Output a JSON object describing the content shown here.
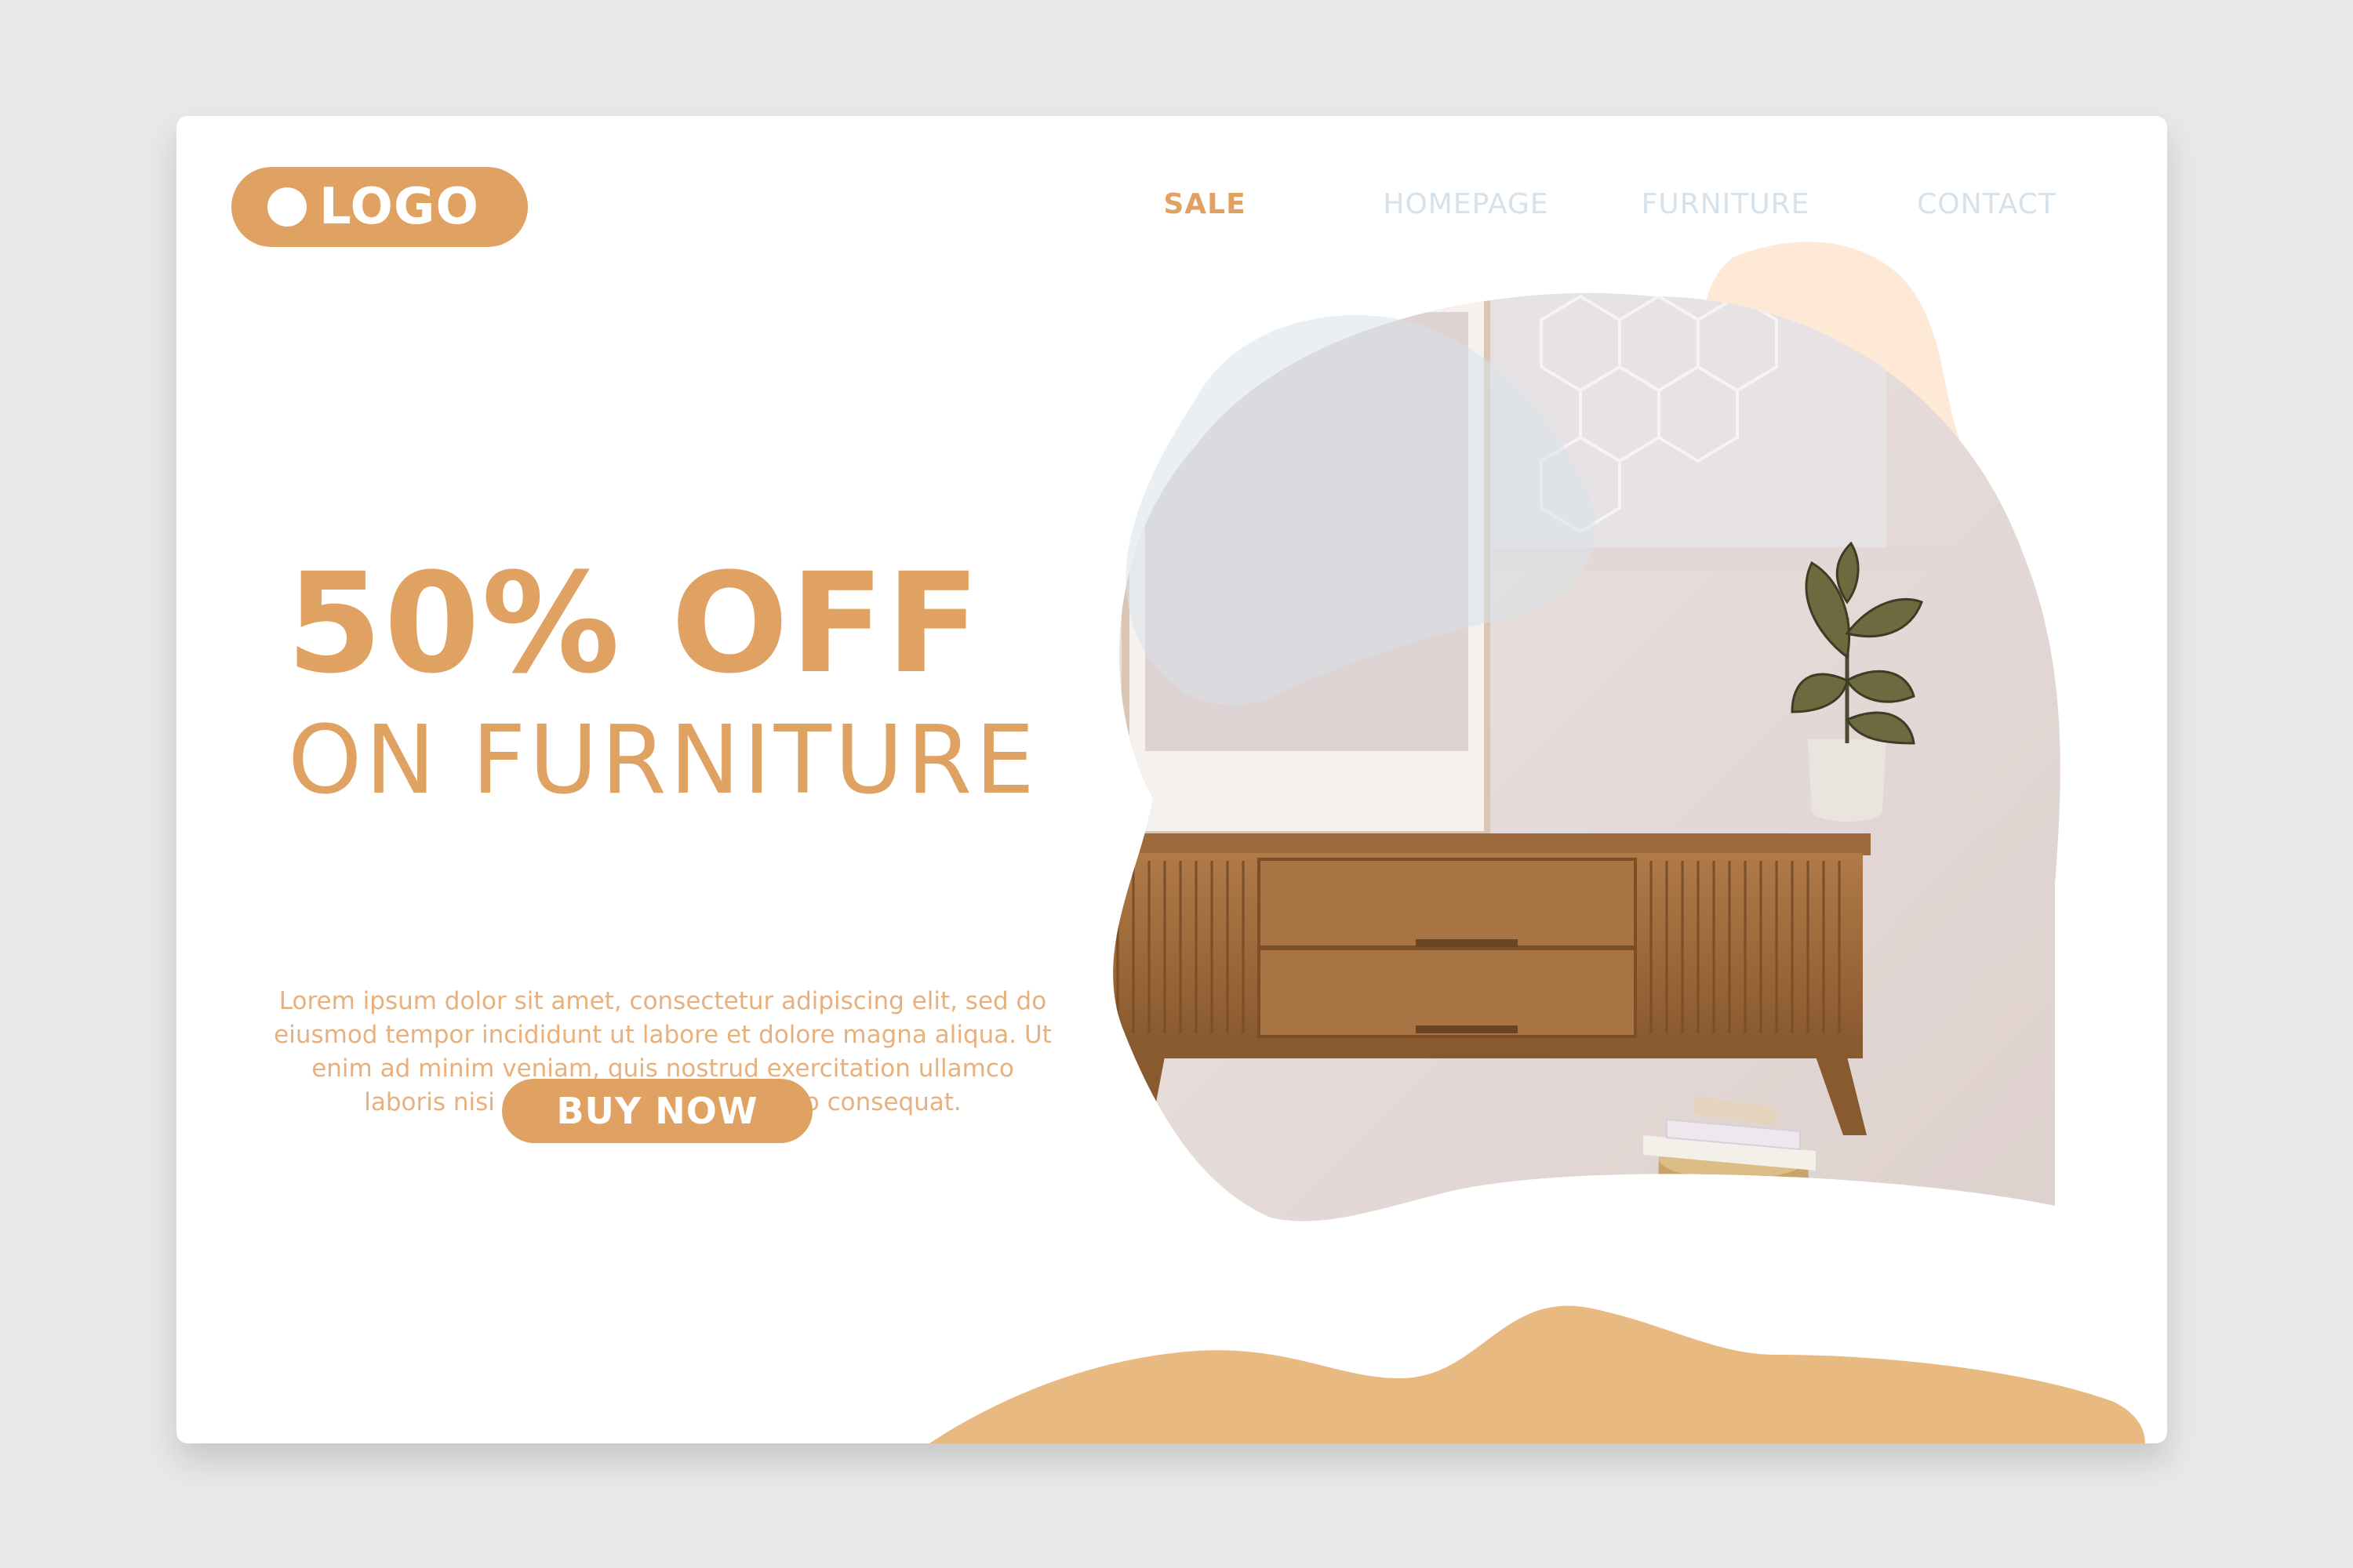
{
  "logo": {
    "text": "LOGO"
  },
  "nav": {
    "items": [
      {
        "label": "SALE",
        "active": true
      },
      {
        "label": "HOMEPAGE",
        "active": false
      },
      {
        "label": "FURNITURE",
        "active": false
      },
      {
        "label": "CONTACT",
        "active": false
      }
    ]
  },
  "hero": {
    "headline": "50% OFF",
    "subheadline": "ON FURNITURE",
    "body": "Lorem ipsum dolor sit amet, consectetur adipiscing elit, sed do eiusmod tempor incididunt ut labore et dolore magna aliqua. Ut enim ad minim veniam, quis nostrud exercitation ullamco laboris nisi ut aliquip ex ea commodo consequat.",
    "cta_label": "BUY NOW"
  },
  "colors": {
    "background": "#e9e8e9",
    "card": "#ffffff",
    "accent": "#e0a262",
    "accent_light": "#e9b982",
    "peach": "#fde9d6",
    "blue_gray": "#e4eaf0",
    "nav_inactive": "#d6e1ea"
  },
  "image": {
    "description_icon": "furniture-photo",
    "elements": [
      "wooden-sideboard-icon",
      "potted-plant-icon",
      "picture-frame-icon",
      "books-icon",
      "wooden-stool-icon"
    ]
  }
}
